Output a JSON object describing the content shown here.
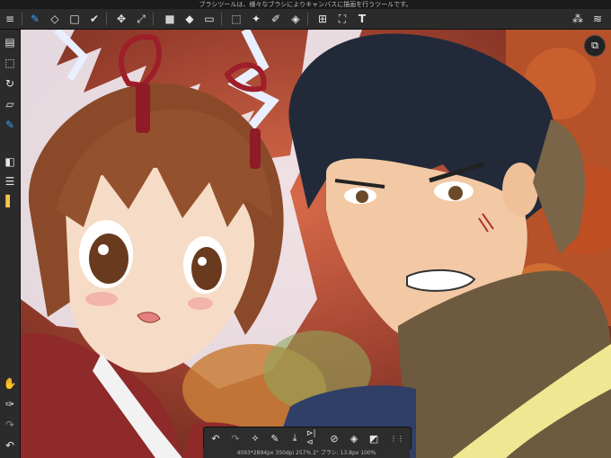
{
  "status": {
    "text": "ブラシツールは、様々なブラシによりキャンバスに描画を行うツールです。"
  },
  "toolbar": {
    "menu": "≡",
    "brush": "✎",
    "eraser": "◇",
    "rect": "□",
    "wand": "✔",
    "move": "✥",
    "transform": "⤢",
    "fill_color": "■",
    "bucket": "◆",
    "gradient": "▭",
    "select": "⬚",
    "magic": "✦",
    "sel_pen": "✐",
    "sel_erase": "◈",
    "ruler": "⊞",
    "crop": "⛶",
    "text": "T",
    "materials": "⁂",
    "layers": "≋"
  },
  "sidebar": {
    "pages": "▤",
    "selection": "⬚",
    "rotate": "↻",
    "ruler": "▱",
    "snap": "✎",
    "color": "◧",
    "layers": "☰",
    "brush_sel": "▌",
    "hand": "✋",
    "eyedropper": "✑",
    "redo": "↷",
    "undo": "↶"
  },
  "canvas": {
    "overlay_icon": "⧉"
  },
  "bottombar": {
    "undo": "↶",
    "redo": "↷",
    "transform": "⟡",
    "pen": "✎",
    "save": "⤓",
    "flip": "⊳|⊲",
    "no_snap": "⊘",
    "clear": "◈",
    "fill": "◩",
    "more": "⋮⋮"
  },
  "bottominfo": {
    "text": "4093*2894px 350dpi 257% 2° ブラシ: 13.8px 100%"
  },
  "colors": {
    "accent": "#2fa3ff",
    "bar_bg": "#2b2b2b"
  }
}
